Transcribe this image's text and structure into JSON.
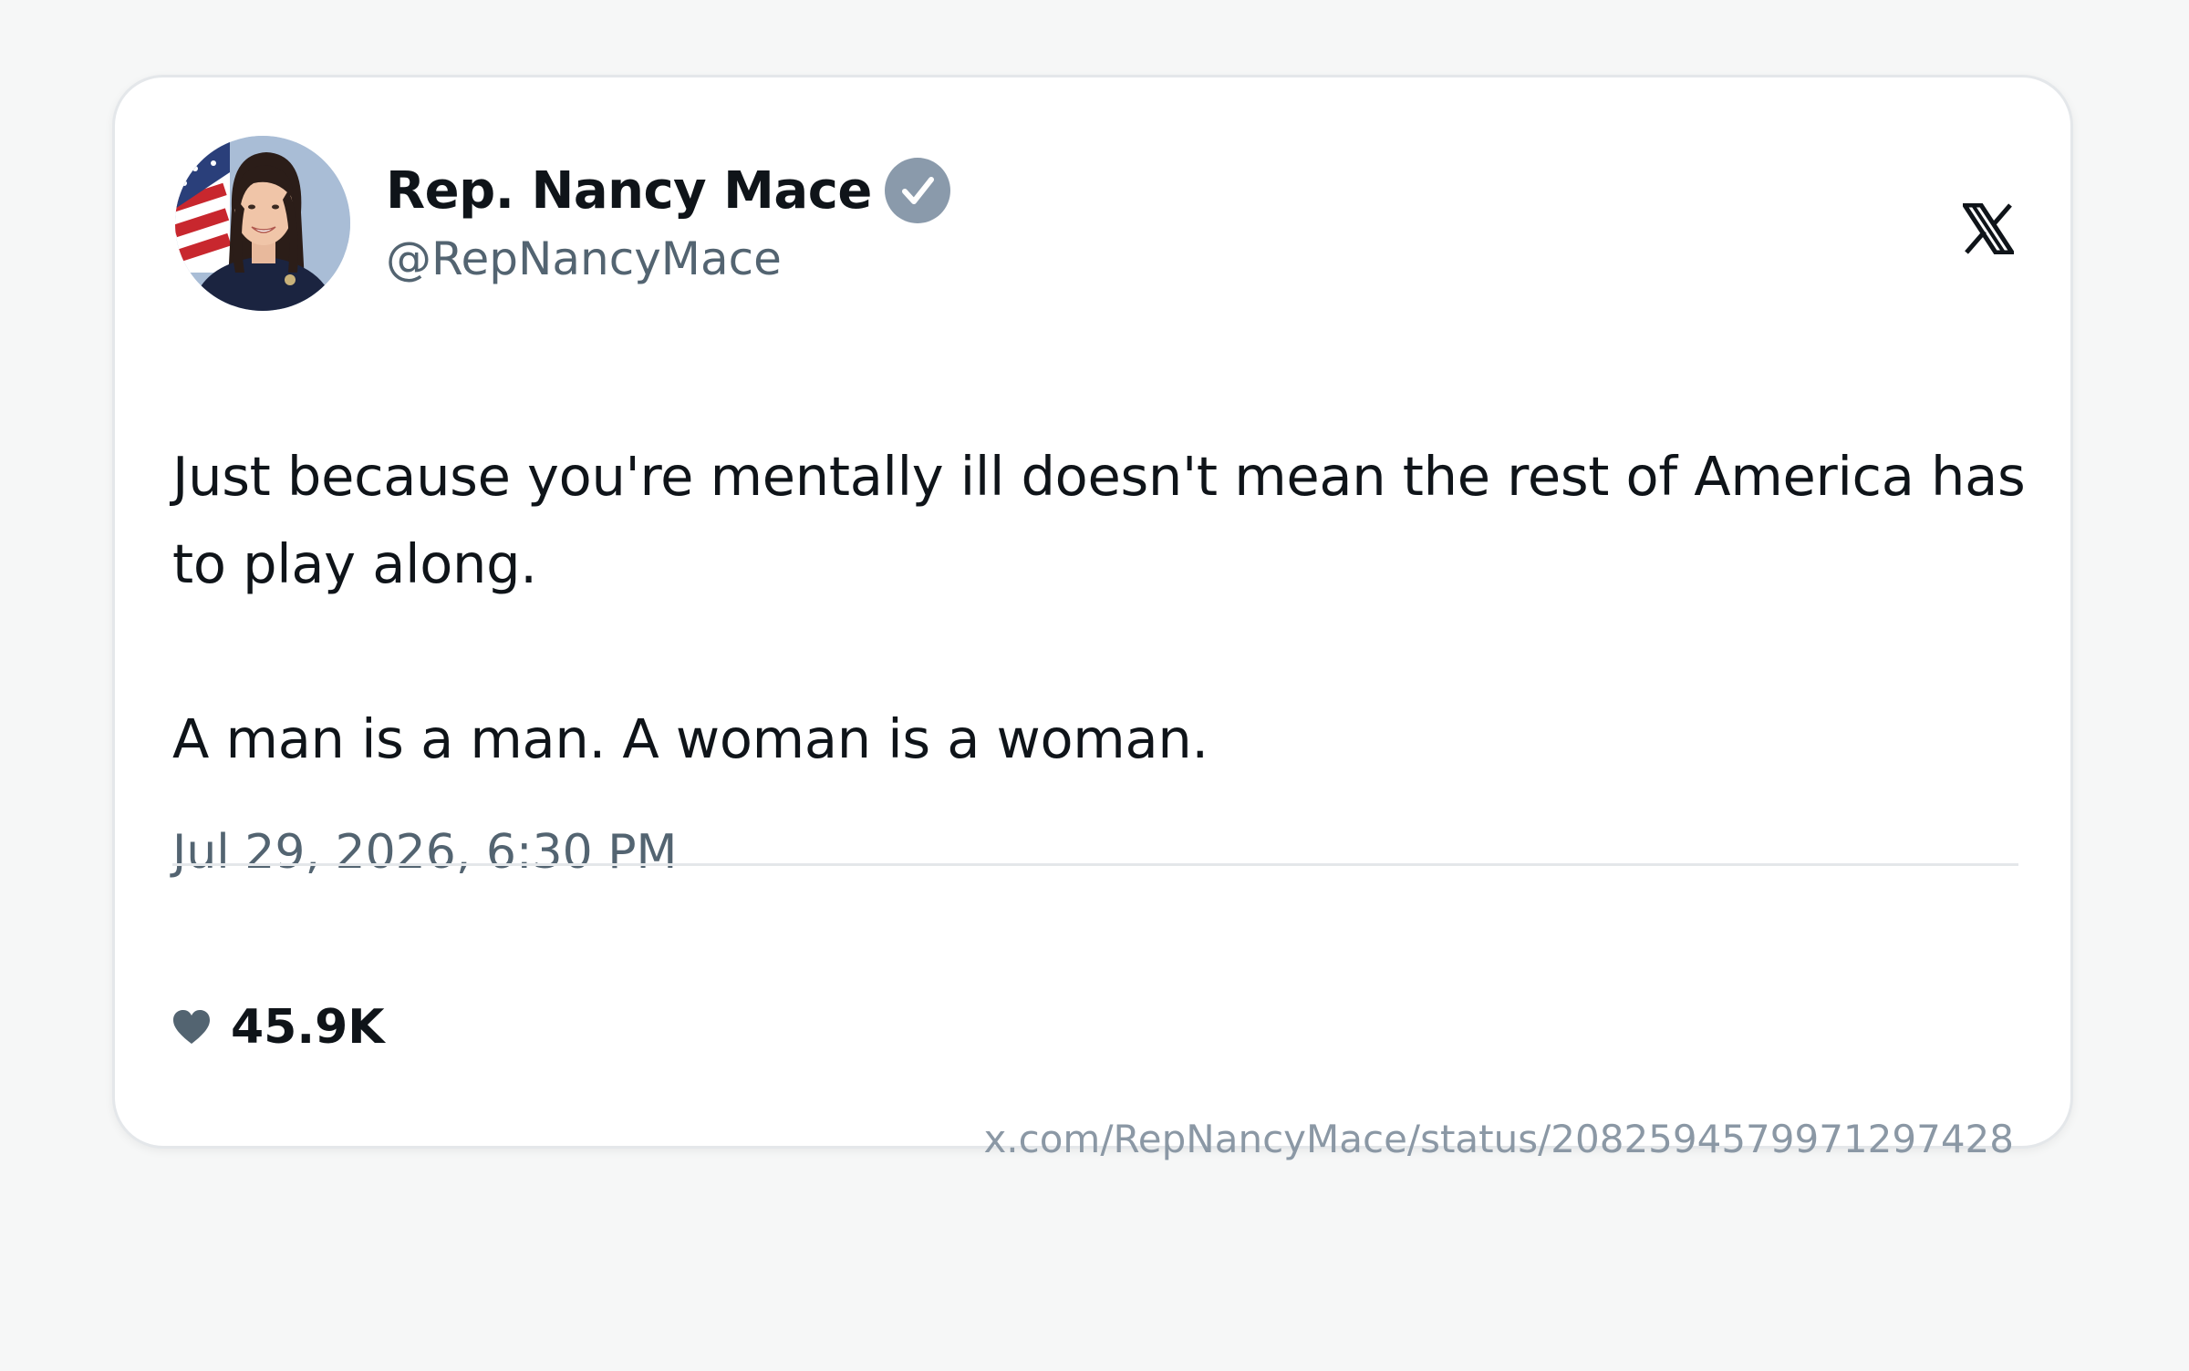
{
  "author": {
    "display_name": "Rep. Nancy Mace",
    "handle": "@RepNancyMace",
    "verified": true,
    "verified_badge_color": "#8a9aab"
  },
  "brand": {
    "logo_icon": "x-logo-icon"
  },
  "tweet": {
    "text": "Just because you're mentally ill doesn't mean the rest of America has to play along.\n\nA man is a man. A woman is a woman.",
    "timestamp": "Jul 29, 2026, 6:30 PM",
    "likes": "45.9K",
    "like_icon": "heart-icon",
    "url": "x.com/RepNancyMace/status/2082594579971297428"
  },
  "colors": {
    "background": "#f6f7f7",
    "card": "#ffffff",
    "primary_text": "#0f1419",
    "secondary_text": "#536471",
    "url_text": "#8b98a5"
  }
}
